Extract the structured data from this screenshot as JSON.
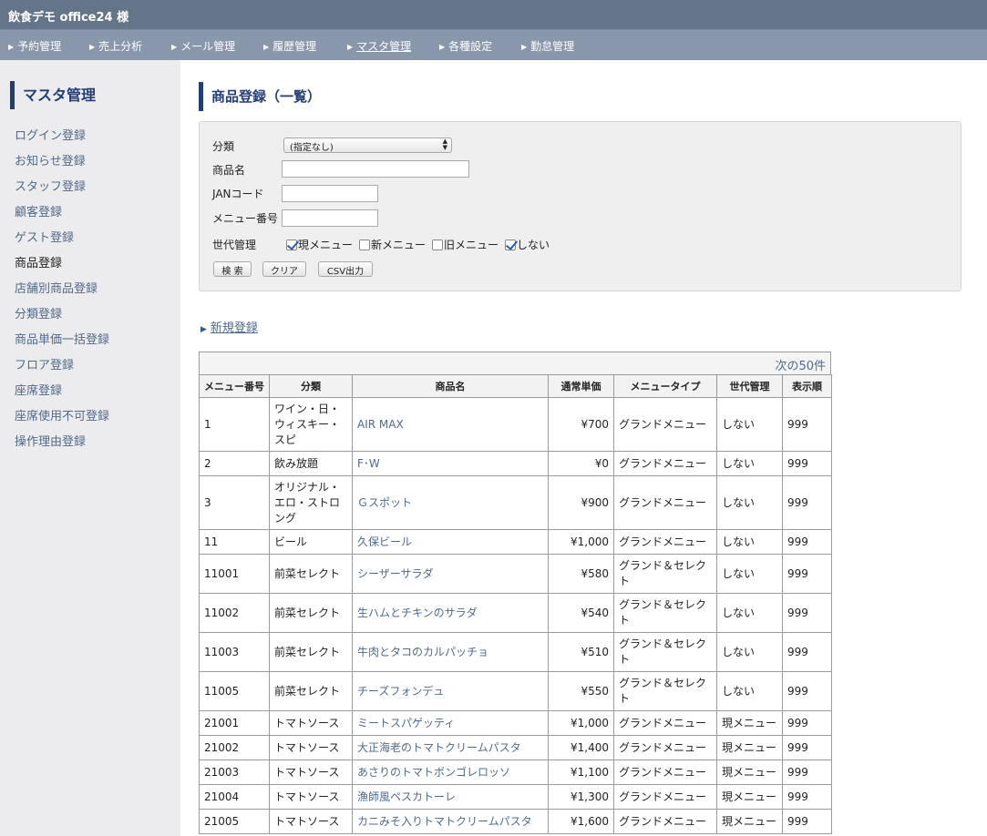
{
  "header": {
    "title": "飲食デモ office24 様"
  },
  "nav": {
    "items": [
      {
        "label": "予約管理"
      },
      {
        "label": "売上分析"
      },
      {
        "label": "メール管理"
      },
      {
        "label": "履歴管理"
      },
      {
        "label": "マスタ管理"
      },
      {
        "label": "各種設定"
      },
      {
        "label": "勤怠管理"
      }
    ]
  },
  "sidebar": {
    "title": "マスタ管理",
    "items": [
      {
        "label": "ログイン登録"
      },
      {
        "label": "お知らせ登録"
      },
      {
        "label": "スタッフ登録"
      },
      {
        "label": "顧客登録"
      },
      {
        "label": "ゲスト登録"
      },
      {
        "label": "商品登録"
      },
      {
        "label": "店舗別商品登録"
      },
      {
        "label": "分類登録"
      },
      {
        "label": "商品単価一括登録"
      },
      {
        "label": "フロア登録"
      },
      {
        "label": "座席登録"
      },
      {
        "label": "座席使用不可登録"
      },
      {
        "label": "操作理由登録"
      }
    ]
  },
  "main": {
    "title": "商品登録（一覧）",
    "search": {
      "category_label": "分類",
      "category_value": "(指定なし)",
      "name_label": "商品名",
      "name_value": "",
      "jan_label": "JANコード",
      "jan_value": "",
      "menu_no_label": "メニュー番号",
      "menu_no_value": "",
      "generation_label": "世代管理",
      "options": [
        {
          "label": "現メニュー",
          "checked": true
        },
        {
          "label": "新メニュー",
          "checked": false
        },
        {
          "label": "旧メニュー",
          "checked": false
        },
        {
          "label": "しない",
          "checked": true
        }
      ],
      "search_button": "検 索",
      "clear_button": "クリア",
      "csv_button": "CSV出力"
    },
    "new_link": "新規登録",
    "pager_next": "次の50件",
    "table": {
      "headers": [
        "メニュー番号",
        "分類",
        "商品名",
        "通常単価",
        "メニュータイプ",
        "世代管理",
        "表示順"
      ],
      "rows": [
        {
          "no": "1",
          "category": "ワイン・日・ウィスキー・スピ",
          "name": "AIR MAX",
          "price": "¥700",
          "type": "グランドメニュー",
          "gen": "しない",
          "order": "999"
        },
        {
          "no": "2",
          "category": "飲み放題",
          "name": "F･W",
          "price": "¥0",
          "type": "グランドメニュー",
          "gen": "しない",
          "order": "999"
        },
        {
          "no": "3",
          "category": "オリジナル・エロ・ストロング",
          "name": "Ｇスポット",
          "price": "¥900",
          "type": "グランドメニュー",
          "gen": "しない",
          "order": "999"
        },
        {
          "no": "11",
          "category": "ビール",
          "name": "久保ビール",
          "price": "¥1,000",
          "type": "グランドメニュー",
          "gen": "しない",
          "order": "999"
        },
        {
          "no": "11001",
          "category": "前菜セレクト",
          "name": "シーザーサラダ",
          "price": "¥580",
          "type": "グランド＆セレクト",
          "gen": "しない",
          "order": "999"
        },
        {
          "no": "11002",
          "category": "前菜セレクト",
          "name": "生ハムとチキンのサラダ",
          "price": "¥540",
          "type": "グランド＆セレクト",
          "gen": "しない",
          "order": "999"
        },
        {
          "no": "11003",
          "category": "前菜セレクト",
          "name": "牛肉とタコのカルパッチョ",
          "price": "¥510",
          "type": "グランド＆セレクト",
          "gen": "しない",
          "order": "999"
        },
        {
          "no": "11005",
          "category": "前菜セレクト",
          "name": "チーズフォンデュ",
          "price": "¥550",
          "type": "グランド＆セレクト",
          "gen": "しない",
          "order": "999"
        },
        {
          "no": "21001",
          "category": "トマトソース",
          "name": "ミートスパゲッティ",
          "price": "¥1,000",
          "type": "グランドメニュー",
          "gen": "現メニュー",
          "order": "999"
        },
        {
          "no": "21002",
          "category": "トマトソース",
          "name": "大正海老のトマトクリームパスタ",
          "price": "¥1,400",
          "type": "グランドメニュー",
          "gen": "現メニュー",
          "order": "999"
        },
        {
          "no": "21003",
          "category": "トマトソース",
          "name": "あさりのトマトボンゴレロッソ",
          "price": "¥1,100",
          "type": "グランドメニュー",
          "gen": "現メニュー",
          "order": "999"
        },
        {
          "no": "21004",
          "category": "トマトソース",
          "name": "漁師風ペスカトーレ",
          "price": "¥1,300",
          "type": "グランドメニュー",
          "gen": "現メニュー",
          "order": "999"
        },
        {
          "no": "21005",
          "category": "トマトソース",
          "name": "カニみそ入りトマトクリームパスタ",
          "price": "¥1,600",
          "type": "グランドメニュー",
          "gen": "現メニュー",
          "order": "999"
        }
      ]
    }
  }
}
